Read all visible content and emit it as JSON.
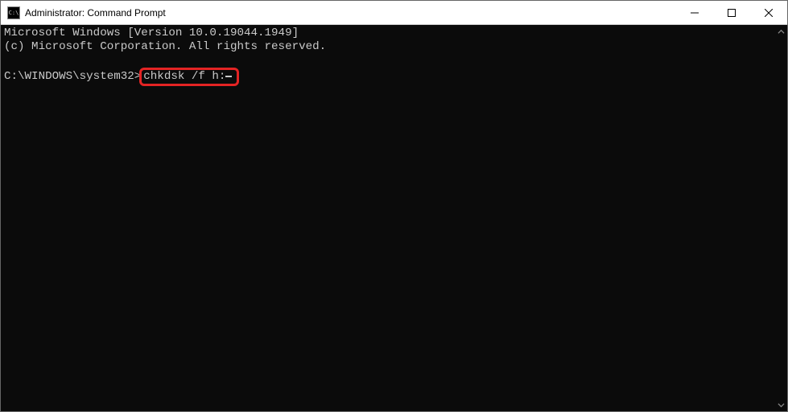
{
  "titlebar": {
    "icon_label": "C:\\",
    "title": "Administrator: Command Prompt"
  },
  "console": {
    "line1": "Microsoft Windows [Version 10.0.19044.1949]",
    "line2": "(c) Microsoft Corporation. All rights reserved.",
    "blank": "",
    "prompt": "C:\\WINDOWS\\system32>",
    "command": "chkdsk /f h:"
  },
  "highlight": {
    "color": "#e42424"
  }
}
